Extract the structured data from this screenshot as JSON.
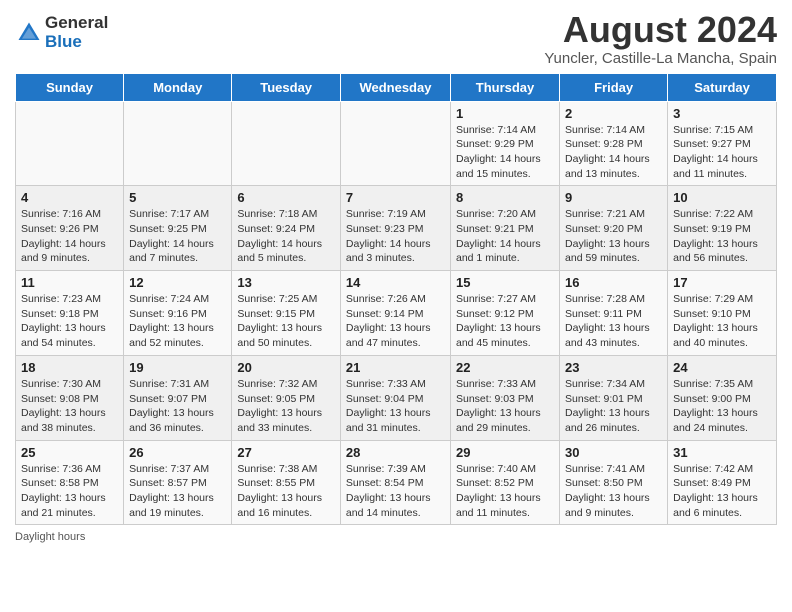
{
  "logo": {
    "general": "General",
    "blue": "Blue"
  },
  "title": "August 2024",
  "subtitle": "Yuncler, Castille-La Mancha, Spain",
  "headers": [
    "Sunday",
    "Monday",
    "Tuesday",
    "Wednesday",
    "Thursday",
    "Friday",
    "Saturday"
  ],
  "weeks": [
    [
      {
        "day": "",
        "info": ""
      },
      {
        "day": "",
        "info": ""
      },
      {
        "day": "",
        "info": ""
      },
      {
        "day": "",
        "info": ""
      },
      {
        "day": "1",
        "info": "Sunrise: 7:14 AM\nSunset: 9:29 PM\nDaylight: 14 hours and 15 minutes."
      },
      {
        "day": "2",
        "info": "Sunrise: 7:14 AM\nSunset: 9:28 PM\nDaylight: 14 hours and 13 minutes."
      },
      {
        "day": "3",
        "info": "Sunrise: 7:15 AM\nSunset: 9:27 PM\nDaylight: 14 hours and 11 minutes."
      }
    ],
    [
      {
        "day": "4",
        "info": "Sunrise: 7:16 AM\nSunset: 9:26 PM\nDaylight: 14 hours and 9 minutes."
      },
      {
        "day": "5",
        "info": "Sunrise: 7:17 AM\nSunset: 9:25 PM\nDaylight: 14 hours and 7 minutes."
      },
      {
        "day": "6",
        "info": "Sunrise: 7:18 AM\nSunset: 9:24 PM\nDaylight: 14 hours and 5 minutes."
      },
      {
        "day": "7",
        "info": "Sunrise: 7:19 AM\nSunset: 9:23 PM\nDaylight: 14 hours and 3 minutes."
      },
      {
        "day": "8",
        "info": "Sunrise: 7:20 AM\nSunset: 9:21 PM\nDaylight: 14 hours and 1 minute."
      },
      {
        "day": "9",
        "info": "Sunrise: 7:21 AM\nSunset: 9:20 PM\nDaylight: 13 hours and 59 minutes."
      },
      {
        "day": "10",
        "info": "Sunrise: 7:22 AM\nSunset: 9:19 PM\nDaylight: 13 hours and 56 minutes."
      }
    ],
    [
      {
        "day": "11",
        "info": "Sunrise: 7:23 AM\nSunset: 9:18 PM\nDaylight: 13 hours and 54 minutes."
      },
      {
        "day": "12",
        "info": "Sunrise: 7:24 AM\nSunset: 9:16 PM\nDaylight: 13 hours and 52 minutes."
      },
      {
        "day": "13",
        "info": "Sunrise: 7:25 AM\nSunset: 9:15 PM\nDaylight: 13 hours and 50 minutes."
      },
      {
        "day": "14",
        "info": "Sunrise: 7:26 AM\nSunset: 9:14 PM\nDaylight: 13 hours and 47 minutes."
      },
      {
        "day": "15",
        "info": "Sunrise: 7:27 AM\nSunset: 9:12 PM\nDaylight: 13 hours and 45 minutes."
      },
      {
        "day": "16",
        "info": "Sunrise: 7:28 AM\nSunset: 9:11 PM\nDaylight: 13 hours and 43 minutes."
      },
      {
        "day": "17",
        "info": "Sunrise: 7:29 AM\nSunset: 9:10 PM\nDaylight: 13 hours and 40 minutes."
      }
    ],
    [
      {
        "day": "18",
        "info": "Sunrise: 7:30 AM\nSunset: 9:08 PM\nDaylight: 13 hours and 38 minutes."
      },
      {
        "day": "19",
        "info": "Sunrise: 7:31 AM\nSunset: 9:07 PM\nDaylight: 13 hours and 36 minutes."
      },
      {
        "day": "20",
        "info": "Sunrise: 7:32 AM\nSunset: 9:05 PM\nDaylight: 13 hours and 33 minutes."
      },
      {
        "day": "21",
        "info": "Sunrise: 7:33 AM\nSunset: 9:04 PM\nDaylight: 13 hours and 31 minutes."
      },
      {
        "day": "22",
        "info": "Sunrise: 7:33 AM\nSunset: 9:03 PM\nDaylight: 13 hours and 29 minutes."
      },
      {
        "day": "23",
        "info": "Sunrise: 7:34 AM\nSunset: 9:01 PM\nDaylight: 13 hours and 26 minutes."
      },
      {
        "day": "24",
        "info": "Sunrise: 7:35 AM\nSunset: 9:00 PM\nDaylight: 13 hours and 24 minutes."
      }
    ],
    [
      {
        "day": "25",
        "info": "Sunrise: 7:36 AM\nSunset: 8:58 PM\nDaylight: 13 hours and 21 minutes."
      },
      {
        "day": "26",
        "info": "Sunrise: 7:37 AM\nSunset: 8:57 PM\nDaylight: 13 hours and 19 minutes."
      },
      {
        "day": "27",
        "info": "Sunrise: 7:38 AM\nSunset: 8:55 PM\nDaylight: 13 hours and 16 minutes."
      },
      {
        "day": "28",
        "info": "Sunrise: 7:39 AM\nSunset: 8:54 PM\nDaylight: 13 hours and 14 minutes."
      },
      {
        "day": "29",
        "info": "Sunrise: 7:40 AM\nSunset: 8:52 PM\nDaylight: 13 hours and 11 minutes."
      },
      {
        "day": "30",
        "info": "Sunrise: 7:41 AM\nSunset: 8:50 PM\nDaylight: 13 hours and 9 minutes."
      },
      {
        "day": "31",
        "info": "Sunrise: 7:42 AM\nSunset: 8:49 PM\nDaylight: 13 hours and 6 minutes."
      }
    ]
  ],
  "footer": "Daylight hours"
}
